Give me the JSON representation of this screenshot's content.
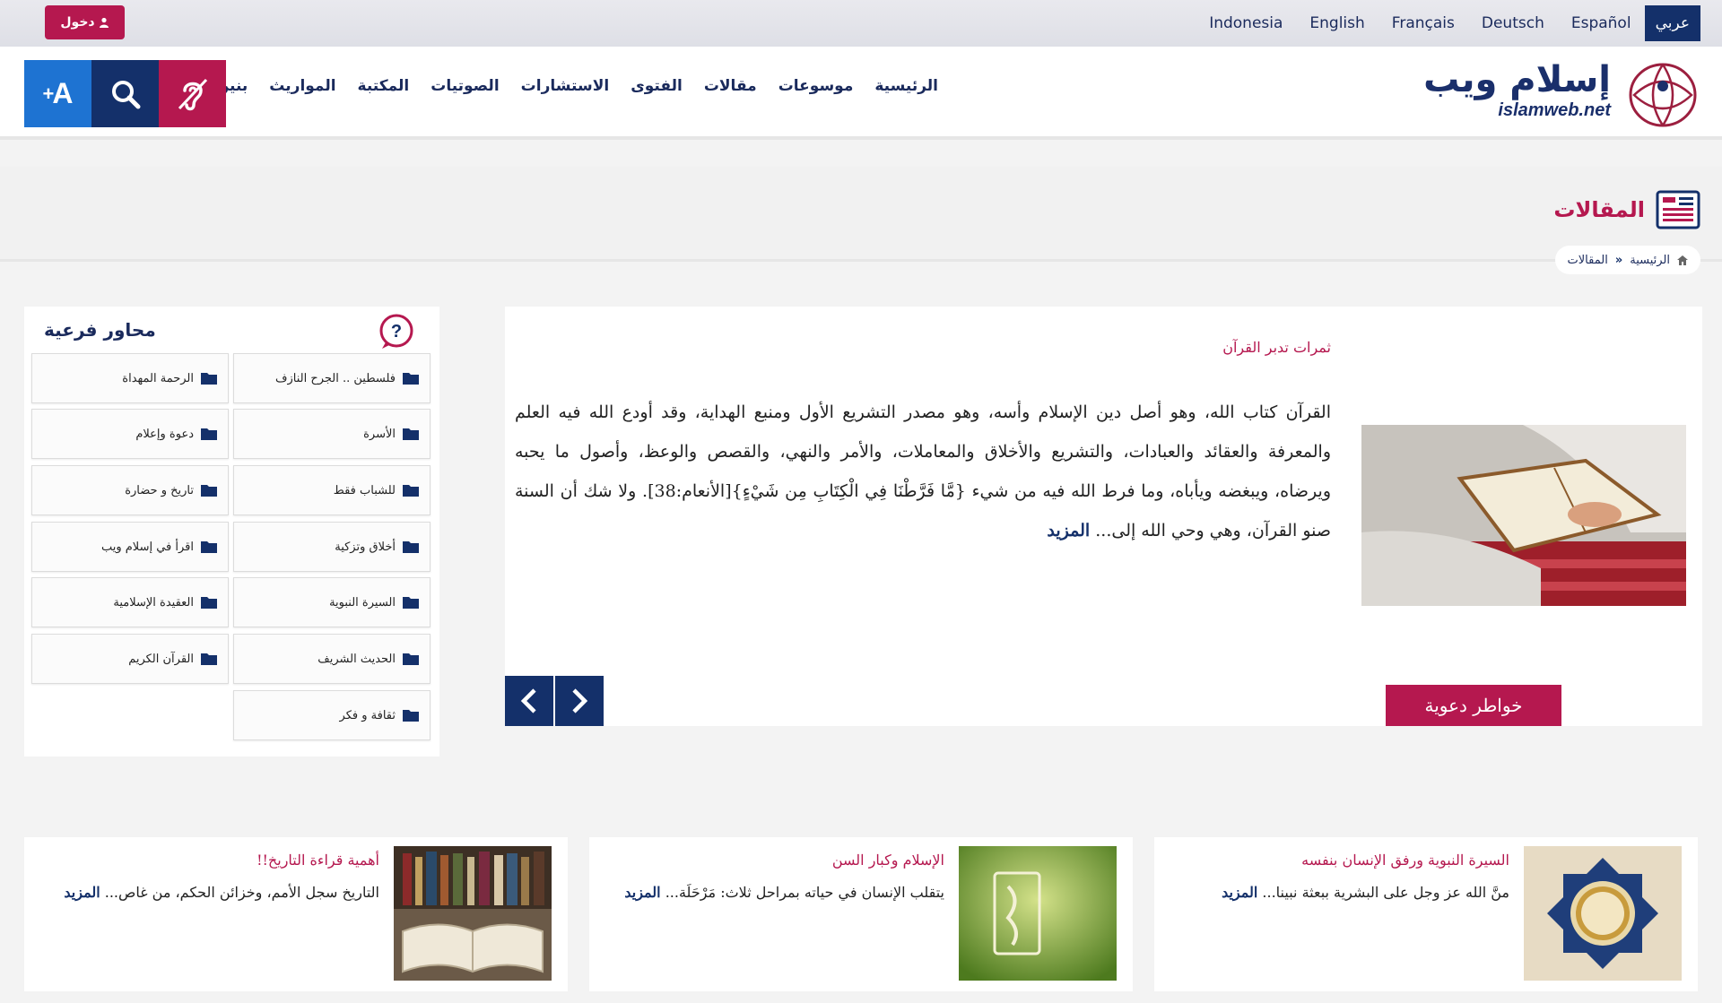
{
  "topbar": {
    "login_label": "دخول",
    "languages": [
      {
        "label": "عربي",
        "active": true
      },
      {
        "label": "Español",
        "active": false
      },
      {
        "label": "Deutsch",
        "active": false
      },
      {
        "label": "Français",
        "active": false
      },
      {
        "label": "English",
        "active": false
      },
      {
        "label": "Indonesia",
        "active": false
      }
    ]
  },
  "header": {
    "logo_ar": "إسلام ويب",
    "logo_en": "islamweb.net",
    "nav": [
      "الرئيسية",
      "موسوعات",
      "مقالات",
      "الفتوى",
      "الاستشارات",
      "الصوتيات",
      "المكتبة",
      "المواريث",
      "بنين وبنات"
    ],
    "font_button": "A"
  },
  "section": {
    "title": "المقالات",
    "breadcrumb": [
      "الرئيسية",
      "المقالات"
    ]
  },
  "article": {
    "title": "ثمرات تدبر القرآن",
    "text": "القرآن كتاب الله، وهو أصل دين الإسلام وأسه، وهو مصدر التشريع الأول ومنبع الهداية، وقد أودع الله فيه العلم والمعرفة والعقائد والعبادات، والتشريع والأخلاق والمعاملات، والأمر والنهي، والقصص والوعظ، وأصول ما يحبه ويرضاه، ويبغضه ويأباه، وما فرط الله فيه من شيء {مَّا فَرَّطْنَا فِي الْكِتَابِ مِن شَيْءٍ}[الأنعام:38]. ولا شك أن السنة صنو القرآن، وهي وحي الله إلى...",
    "more": "المزيد",
    "tag": "خواطر دعوية"
  },
  "sidebar": {
    "title": "محاور فرعية",
    "topics_right": [
      "فلسطين .. الجرح النازف",
      "الأسرة",
      "للشباب فقط",
      "أخلاق وتزكية",
      "السيرة النبوية",
      "الحديث الشريف",
      "ثقافة و فكر"
    ],
    "topics_left": [
      "الرحمة المهداة",
      "دعوة وإعلام",
      "تاريخ و حضارة",
      "اقرأ في إسلام ويب",
      "العقيدة الإسلامية",
      "القرآن الكريم"
    ]
  },
  "cards": [
    {
      "title": "السيرة النبوية ورفق الإنسان بنفسه",
      "text": "منَّ الله عز وجل على البشرية ببعثة نبينا...",
      "more": "المزيد"
    },
    {
      "title": "الإسلام وكبار السن",
      "text": "يتقلب الإنسان في حياته بمراحل ثلاث: مَرْحَلَة...",
      "more": "المزيد"
    },
    {
      "title": "أهمية قراءة التاريخ!!",
      "text": "التاريخ سجل الأمم، وخزائن الحكم، من غاص...",
      "more": "المزيد"
    }
  ],
  "colors": {
    "brand_navy": "#14306a",
    "brand_magenta": "#b5184f",
    "accent_blue": "#1e73d2"
  }
}
